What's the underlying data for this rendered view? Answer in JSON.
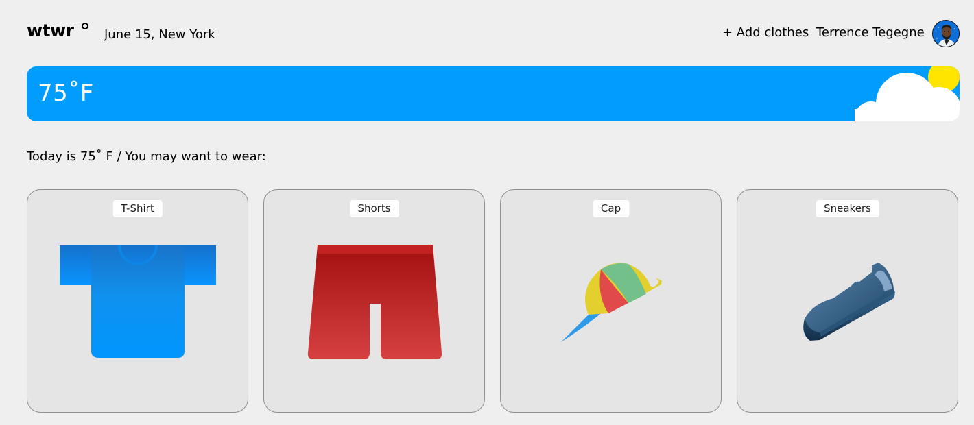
{
  "header": {
    "logo": "wtwr",
    "date_location": "June 15, New York",
    "add_clothes_label": "+ Add clothes",
    "user_name": "Terrence Tegegne"
  },
  "weather": {
    "temperature": "75˚F",
    "condition_icon": "sun-cloud-icon"
  },
  "main": {
    "suggestion_text": "Today is 75˚ F / You may want to wear:",
    "items": [
      {
        "name": "T-Shirt",
        "icon": "tshirt-icon"
      },
      {
        "name": "Shorts",
        "icon": "shorts-icon"
      },
      {
        "name": "Cap",
        "icon": "cap-icon"
      },
      {
        "name": "Sneakers",
        "icon": "sneaker-icon"
      }
    ]
  },
  "colors": {
    "banner": "#009dff",
    "background": "#efefef",
    "card": "#e5e5e5"
  }
}
